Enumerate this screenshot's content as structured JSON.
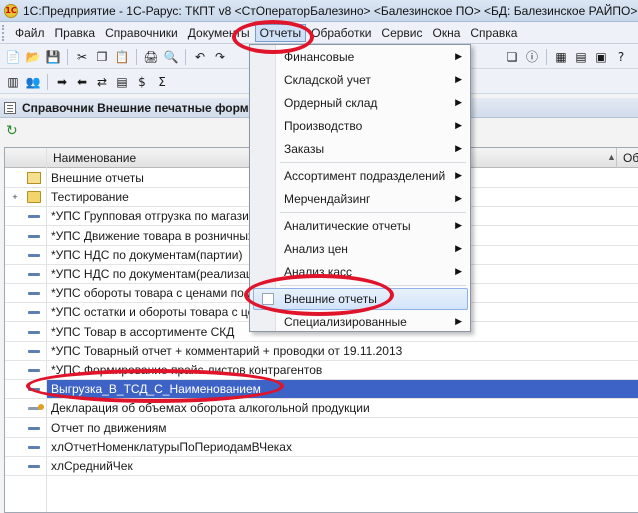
{
  "window": {
    "logo": "1С",
    "title": "1С:Предприятие - 1С-Рарус: ТКПТ v8 <СтОператорБалезино> <Балезинское ПО> <БД: Балезинское РАЙПО>"
  },
  "menubar": [
    {
      "label": "Файл",
      "key": "Ф"
    },
    {
      "label": "Правка",
      "key": "П"
    },
    {
      "label": "Справочники",
      "key": ""
    },
    {
      "label": "Документы",
      "key": ""
    },
    {
      "label": "Отчеты",
      "key": "",
      "active": true
    },
    {
      "label": "Обработки",
      "key": ""
    },
    {
      "label": "Сервис",
      "key": ""
    },
    {
      "label": "Окна",
      "key": ""
    },
    {
      "label": "Справка",
      "key": ""
    }
  ],
  "subwindow": {
    "title": "Справочник Внешние печатные формы"
  },
  "grid": {
    "columns": [
      "Наименование",
      "Объе"
    ],
    "rows": [
      {
        "name": "Внешние отчеты",
        "kind": "folder-open",
        "mark": ""
      },
      {
        "name": "Тестирование",
        "kind": "folder",
        "mark": "+"
      },
      {
        "name": "*УПС Групповая отгрузка по магазинам",
        "kind": "elem",
        "mark": ""
      },
      {
        "name": "*УПС Движение товара в розничных це",
        "kind": "elem",
        "mark": ""
      },
      {
        "name": "*УПС НДС по документам(партии)",
        "kind": "elem",
        "mark": ""
      },
      {
        "name": "*УПС НДС по документам(реализаци)",
        "kind": "elem",
        "mark": ""
      },
      {
        "name": "*УПС обороты товара с ценами по до",
        "kind": "elem",
        "mark": ""
      },
      {
        "name": "*УПС остатки и обороты товара с цена",
        "kind": "elem",
        "mark": ""
      },
      {
        "name": "*УПС Товар в ассортименте СКД",
        "kind": "elem",
        "mark": ""
      },
      {
        "name": "*УПС Товарный отчет + комментарий + проводки от 19.11.2013",
        "kind": "elem",
        "mark": ""
      },
      {
        "name": "*УПС Формирование прайс-листов контрагентов",
        "kind": "elem",
        "mark": ""
      },
      {
        "name": "Выгрузка_В_ТСД_С_Наименованием",
        "kind": "elem",
        "mark": "",
        "selected": true
      },
      {
        "name": "Декларация об объемах оборота алкогольной продукции",
        "kind": "elem-del",
        "mark": ""
      },
      {
        "name": "Отчет по движениям",
        "kind": "elem",
        "mark": ""
      },
      {
        "name": "хлОтчетНоменклатурыПоПериодамВЧеках",
        "kind": "elem",
        "mark": ""
      },
      {
        "name": "хлСреднийЧек",
        "kind": "elem",
        "mark": ""
      }
    ]
  },
  "reports_menu": [
    {
      "label": "Финансовые",
      "submenu": true
    },
    {
      "label": "Складской учет",
      "submenu": true
    },
    {
      "label": "Ордерный склад",
      "submenu": true
    },
    {
      "label": "Производство",
      "submenu": true
    },
    {
      "label": "Заказы",
      "submenu": true
    },
    {
      "sep": true
    },
    {
      "label": "Ассортимент подразделений",
      "submenu": true
    },
    {
      "label": "Мерчендайзинг",
      "submenu": true
    },
    {
      "sep": true
    },
    {
      "label": "Аналитические отчеты",
      "submenu": true
    },
    {
      "label": "Анализ цен",
      "submenu": true
    },
    {
      "label": "Анализ касс",
      "submenu": true
    },
    {
      "sep": true
    },
    {
      "label": "Внешние отчеты",
      "submenu": false,
      "highlight": true,
      "icon": true
    },
    {
      "label": "Специализированные",
      "submenu": true
    }
  ],
  "icons": {
    "submenu_arrow": "▶",
    "refresh": "↻",
    "sort_arrow": "▲",
    "tree_expand": "+"
  },
  "colors": {
    "selection": "#3d63c6",
    "annotation": "#e0142a",
    "menu_highlight": "#d3e4f9"
  }
}
